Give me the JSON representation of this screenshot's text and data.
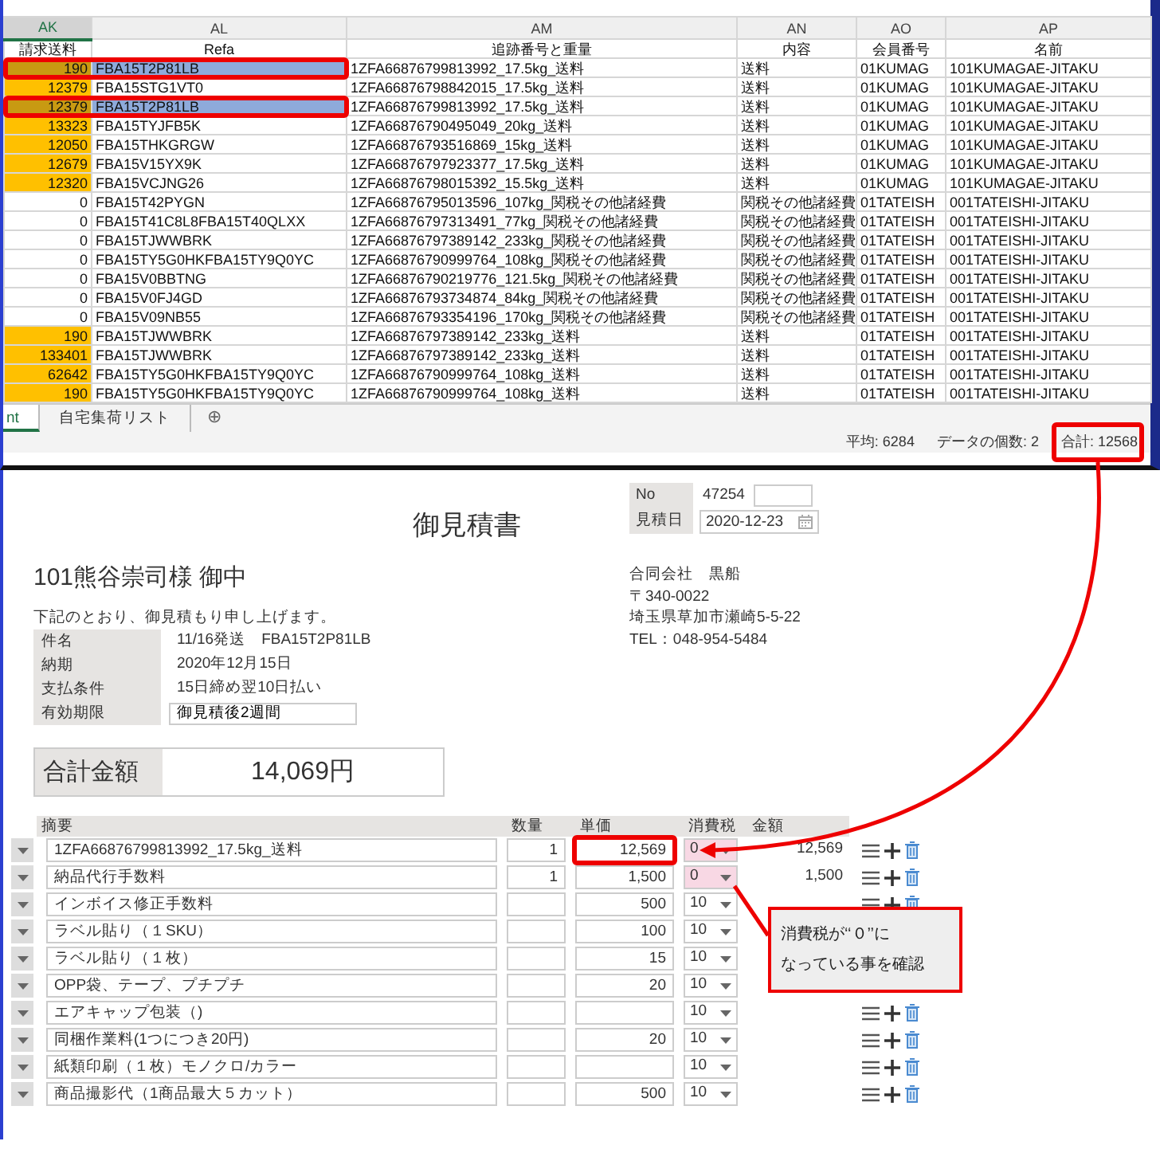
{
  "spreadsheet": {
    "columns": [
      {
        "letter": "AK",
        "selected": true
      },
      {
        "letter": "AL",
        "selected": false
      },
      {
        "letter": "AM",
        "selected": false
      },
      {
        "letter": "AN",
        "selected": false
      },
      {
        "letter": "AO",
        "selected": false
      },
      {
        "letter": "AP",
        "selected": false
      }
    ],
    "header_row": [
      "請求送料",
      "Refa",
      "追跡番号と重量",
      "内容",
      "会員番号",
      "名前"
    ],
    "rows": [
      {
        "cells": [
          "190",
          "FBA15T2P81LB",
          "1ZFA66876799813992_17.5kg_送料",
          "送料",
          "01KUMAG",
          "101KUMAGAE-JITAKU"
        ],
        "highlighted": true,
        "selected": true,
        "annotated": true
      },
      {
        "cells": [
          "12379",
          "FBA15STG1VT0",
          "1ZFA66876798842015_17.5kg_送料",
          "送料",
          "01KUMAG",
          "101KUMAGAE-JITAKU"
        ],
        "highlighted": true,
        "selected": false,
        "annotated": false
      },
      {
        "cells": [
          "12379",
          "FBA15T2P81LB",
          "1ZFA66876799813992_17.5kg_送料",
          "送料",
          "01KUMAG",
          "101KUMAGAE-JITAKU"
        ],
        "highlighted": true,
        "selected": true,
        "annotated": true
      },
      {
        "cells": [
          "13323",
          "FBA15TYJFB5K",
          "1ZFA66876790495049_20kg_送料",
          "送料",
          "01KUMAG",
          "101KUMAGAE-JITAKU"
        ],
        "highlighted": true,
        "selected": false,
        "annotated": false
      },
      {
        "cells": [
          "12050",
          "FBA15THKGRGW",
          "1ZFA66876793516869_15kg_送料",
          "送料",
          "01KUMAG",
          "101KUMAGAE-JITAKU"
        ],
        "highlighted": true,
        "selected": false,
        "annotated": false
      },
      {
        "cells": [
          "12679",
          "FBA15V15YX9K",
          "1ZFA66876797923377_17.5kg_送料",
          "送料",
          "01KUMAG",
          "101KUMAGAE-JITAKU"
        ],
        "highlighted": true,
        "selected": false,
        "annotated": false
      },
      {
        "cells": [
          "12320",
          "FBA15VCJNG26",
          "1ZFA66876798015392_15.5kg_送料",
          "送料",
          "01KUMAG",
          "101KUMAGAE-JITAKU"
        ],
        "highlighted": true,
        "selected": false,
        "annotated": false
      },
      {
        "cells": [
          "0",
          "FBA15T42PYGN",
          "1ZFA66876795013596_107kg_関税その他諸経費",
          "関税その他諸経費",
          "01TATEISH",
          "001TATEISHI-JITAKU"
        ],
        "highlighted": false,
        "selected": false,
        "annotated": false
      },
      {
        "cells": [
          "0",
          "FBA15T41C8L8FBA15T40QLXX",
          "1ZFA66876797313491_77kg_関税その他諸経費",
          "関税その他諸経費",
          "01TATEISH",
          "001TATEISHI-JITAKU"
        ],
        "highlighted": false,
        "selected": false,
        "annotated": false
      },
      {
        "cells": [
          "0",
          "FBA15TJWWBRK",
          "1ZFA66876797389142_233kg_関税その他諸経費",
          "関税その他諸経費",
          "01TATEISH",
          "001TATEISHI-JITAKU"
        ],
        "highlighted": false,
        "selected": false,
        "annotated": false
      },
      {
        "cells": [
          "0",
          "FBA15TY5G0HKFBA15TY9Q0YC",
          "1ZFA66876790999764_108kg_関税その他諸経費",
          "関税その他諸経費",
          "01TATEISH",
          "001TATEISHI-JITAKU"
        ],
        "highlighted": false,
        "selected": false,
        "annotated": false
      },
      {
        "cells": [
          "0",
          "FBA15V0BBTNG",
          "1ZFA66876790219776_121.5kg_関税その他諸経費",
          "関税その他諸経費",
          "01TATEISH",
          "001TATEISHI-JITAKU"
        ],
        "highlighted": false,
        "selected": false,
        "annotated": false
      },
      {
        "cells": [
          "0",
          "FBA15V0FJ4GD",
          "1ZFA66876793734874_84kg_関税その他諸経費",
          "関税その他諸経費",
          "01TATEISH",
          "001TATEISHI-JITAKU"
        ],
        "highlighted": false,
        "selected": false,
        "annotated": false
      },
      {
        "cells": [
          "0",
          "FBA15V09NB55",
          "1ZFA66876793354196_170kg_関税その他諸経費",
          "関税その他諸経費",
          "01TATEISH",
          "001TATEISHI-JITAKU"
        ],
        "highlighted": false,
        "selected": false,
        "annotated": false
      },
      {
        "cells": [
          "190",
          "FBA15TJWWBRK",
          "1ZFA66876797389142_233kg_送料",
          "送料",
          "01TATEISH",
          "001TATEISHI-JITAKU"
        ],
        "highlighted": true,
        "selected": false,
        "annotated": false
      },
      {
        "cells": [
          "133401",
          "FBA15TJWWBRK",
          "1ZFA66876797389142_233kg_送料",
          "送料",
          "01TATEISH",
          "001TATEISHI-JITAKU"
        ],
        "highlighted": true,
        "selected": false,
        "annotated": false
      },
      {
        "cells": [
          "62642",
          "FBA15TY5G0HKFBA15TY9Q0YC",
          "1ZFA66876790999764_108kg_送料",
          "送料",
          "01TATEISH",
          "001TATEISHI-JITAKU"
        ],
        "highlighted": true,
        "selected": false,
        "annotated": false
      },
      {
        "cells": [
          "190",
          "FBA15TY5G0HKFBA15TY9Q0YC",
          "1ZFA66876790999764_108kg_送料",
          "送料",
          "01TATEISH",
          "001TATEISHI-JITAKU"
        ],
        "highlighted": true,
        "selected": false,
        "annotated": false
      }
    ],
    "sheet_tabs": [
      {
        "label": "nt",
        "selected": true
      },
      {
        "label": "自宅集荷リスト",
        "selected": false
      }
    ],
    "add_sheet_button": "⊕",
    "status": {
      "average": "平均: 6284",
      "count": "データの個数: 2",
      "sum": "合計: 12568",
      "sum_annotated": true
    }
  },
  "estimate": {
    "title": "御見積書",
    "recipient": "101熊谷崇司様 御中",
    "intro": "下記のとおり、御見積もり申し上げます。",
    "details": [
      {
        "label": "件名",
        "value": "11/16発送　FBA15T2P81LB",
        "kind": "text"
      },
      {
        "label": "納期",
        "value": "2020年12月15日",
        "kind": "text"
      },
      {
        "label": "支払条件",
        "value": "15日締め翌10日払い",
        "kind": "text"
      },
      {
        "label": "有効期限",
        "value": "御見積後2週間",
        "kind": "field"
      }
    ],
    "meta": {
      "no_label": "No",
      "no_value": "47254",
      "date_label": "見積日",
      "date_value": "2020-12-23"
    },
    "company_lines": [
      "合同会社　黒船",
      "〒340-0022",
      "埼玉県草加市瀬崎5-5-22",
      "TEL：048-954-5484"
    ],
    "total": {
      "label": "合計金額",
      "value": "14,069円"
    },
    "line_columns": [
      "摘要",
      "数量",
      "単価",
      "消費税",
      "金額"
    ],
    "lines": [
      {
        "description": "1ZFA66876799813992_17.5kg_送料",
        "quantity": "1",
        "unit_price": "12,569",
        "tax": "0",
        "amount": "12,569",
        "tax_highlighted": true,
        "price_annotated": true,
        "tax_callout": false
      },
      {
        "description": "納品代行手数料",
        "quantity": "1",
        "unit_price": "1,500",
        "tax": "0",
        "amount": "1,500",
        "tax_highlighted": true,
        "price_annotated": false,
        "tax_callout": true
      },
      {
        "description": "インボイス修正手数料",
        "unit_price": "500",
        "tax": "10",
        "tax_highlighted": false,
        "price_annotated": false,
        "tax_callout": false
      },
      {
        "description": "ラベル貼り（１SKU）",
        "unit_price": "100",
        "tax": "10",
        "tax_highlighted": false,
        "price_annotated": false,
        "tax_callout": false
      },
      {
        "description": "ラベル貼り（１枚）",
        "unit_price": "15",
        "tax": "10",
        "tax_highlighted": false,
        "price_annotated": false,
        "tax_callout": false
      },
      {
        "description": "OPP袋、テープ、プチプチ",
        "unit_price": "20",
        "tax": "10",
        "tax_highlighted": false,
        "price_annotated": false,
        "tax_callout": false
      },
      {
        "description": "エアキャップ包装（)",
        "tax": "10",
        "tax_highlighted": false,
        "price_annotated": false,
        "tax_callout": false
      },
      {
        "description": "同梱作業料(1つにつき20円)",
        "unit_price": "20",
        "tax": "10",
        "tax_highlighted": false,
        "price_annotated": false,
        "tax_callout": false
      },
      {
        "description": "紙類印刷（１枚）モノクロ/カラー",
        "tax": "10",
        "tax_highlighted": false,
        "price_annotated": false,
        "tax_callout": false
      },
      {
        "description": "商品撮影代（1商品最大５カット）",
        "unit_price": "500",
        "tax": "10",
        "tax_highlighted": false,
        "price_annotated": false,
        "tax_callout": false
      }
    ],
    "callout_lines": [
      "消費税が‘‘０’’に",
      "なっている事を確認"
    ]
  }
}
